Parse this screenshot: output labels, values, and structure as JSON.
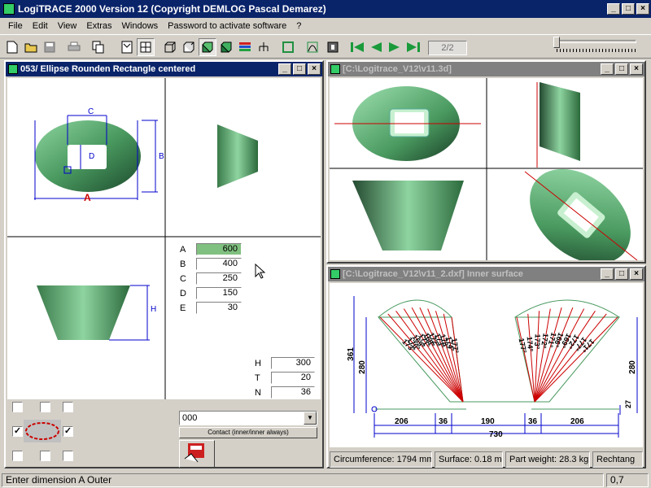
{
  "window": {
    "title": "LogiTRACE 2000  Version 12  (Copyright DEMLOG Pascal Demarez)"
  },
  "menu": [
    "File",
    "Edit",
    "View",
    "Extras",
    "Windows",
    "Password to activate software",
    "?"
  ],
  "toolbar": {
    "page_count": "2/2"
  },
  "child_windows": {
    "editor": {
      "title": "053/ Ellipse Rounden Rectangle centered"
    },
    "view3d": {
      "title": "[C:\\Logitrace_V12\\v11.3d]"
    },
    "inner": {
      "title": "[C:\\Logitrace_V12\\v11_2.dxf]  Inner surface"
    }
  },
  "drawing_labels": {
    "c": "C",
    "b": "B",
    "d": "D",
    "a": "A",
    "h": "H"
  },
  "params": [
    {
      "label": "A",
      "value": "600"
    },
    {
      "label": "B",
      "value": "400"
    },
    {
      "label": "C",
      "value": "250"
    },
    {
      "label": "D",
      "value": "150"
    },
    {
      "label": "E",
      "value": "30"
    }
  ],
  "params2": [
    {
      "label": "H",
      "value": "300"
    },
    {
      "label": "T",
      "value": "20"
    },
    {
      "label": "N",
      "value": "36"
    }
  ],
  "contact": {
    "selected": "000",
    "button_label": "Contact (inner/inner always)"
  },
  "unfold": {
    "angles_left": [
      "173°",
      "170°",
      "169°",
      "171°",
      "168°",
      "172°",
      "173°",
      "178°",
      "174°",
      "177°"
    ],
    "angles_right": [
      "177°",
      "174°",
      "173°",
      "172°",
      "171°",
      "166°",
      "169°",
      "172°",
      "177°",
      "171°"
    ],
    "dims": {
      "left_height": "361",
      "inner_height": "280",
      "right_height": "280",
      "bottom_small": "27",
      "seg1": "206",
      "seg2": "36",
      "seg3": "190",
      "seg4": "36",
      "seg5": "206",
      "total": "730"
    }
  },
  "info": {
    "circumference": "Circumference: 1794 mm",
    "surface": "Surface: 0.18 m²",
    "weight": "Part weight: 28.3 kg",
    "extra": "Rechtang"
  },
  "status": {
    "message": "Enter dimension A Outer",
    "value": "0,7"
  },
  "colors": {
    "title_active": "#0a246a",
    "title_inactive": "#808080",
    "shape_green": "#5aa870",
    "dim_blue": "#0000cc",
    "dim_red": "#cc0000"
  }
}
